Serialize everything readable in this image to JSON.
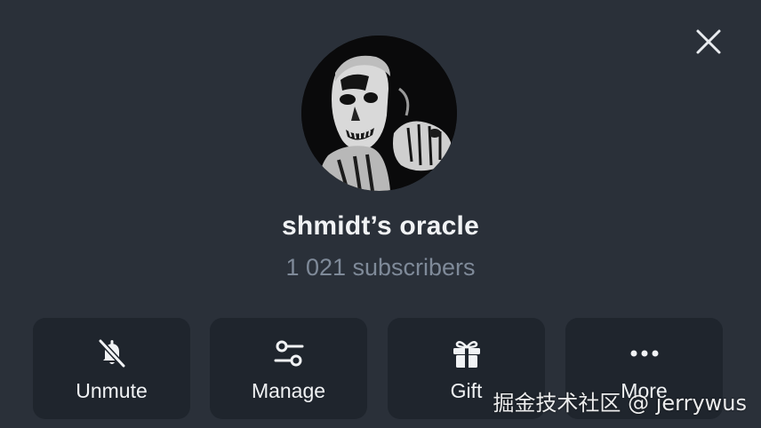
{
  "channel": {
    "name": "shmidt’s oracle",
    "subscribers": "1 021 subscribers"
  },
  "actions": [
    {
      "label": "Unmute",
      "icon": "bell-off-icon"
    },
    {
      "label": "Manage",
      "icon": "sliders-icon"
    },
    {
      "label": "Gift",
      "icon": "gift-icon"
    },
    {
      "label": "More",
      "icon": "more-dots-icon"
    }
  ],
  "close": {
    "icon": "close-icon"
  },
  "watermark": "掘金技术社区 @ jerrywus",
  "colors": {
    "background": "#2a3039",
    "button": "#1f252d",
    "text": "#f1f3f5",
    "muted": "#7f8a99"
  }
}
